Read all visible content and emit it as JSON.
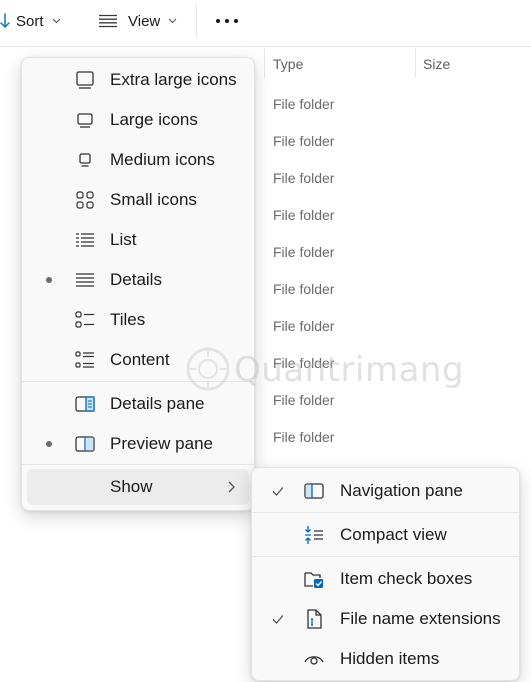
{
  "toolbar": {
    "sort_label": "Sort",
    "view_label": "View",
    "more_icon": "more-icon"
  },
  "columns": [
    {
      "label": "Type"
    },
    {
      "label": "Size"
    }
  ],
  "rows": [
    {
      "type": "File folder"
    },
    {
      "type": "File folder"
    },
    {
      "type": "File folder"
    },
    {
      "type": "File folder"
    },
    {
      "type": "File folder"
    },
    {
      "type": "File folder"
    },
    {
      "type": "File folder"
    },
    {
      "type": "File folder"
    },
    {
      "type": "File folder"
    },
    {
      "type": "File folder"
    }
  ],
  "view_menu": {
    "items": [
      {
        "label": "Extra large icons",
        "icon": "extra-large-icons-icon",
        "selected": false
      },
      {
        "label": "Large icons",
        "icon": "large-icons-icon",
        "selected": false
      },
      {
        "label": "Medium icons",
        "icon": "medium-icons-icon",
        "selected": false
      },
      {
        "label": "Small icons",
        "icon": "small-icons-icon",
        "selected": false
      },
      {
        "label": "List",
        "icon": "list-icon",
        "selected": false
      },
      {
        "label": "Details",
        "icon": "details-icon",
        "selected": true
      },
      {
        "label": "Tiles",
        "icon": "tiles-icon",
        "selected": false
      },
      {
        "label": "Content",
        "icon": "content-icon",
        "selected": false
      },
      {
        "label": "Details pane",
        "icon": "details-pane-icon",
        "selected": false
      },
      {
        "label": "Preview pane",
        "icon": "preview-pane-icon",
        "selected": true
      }
    ],
    "show_label": "Show"
  },
  "show_menu": {
    "items": [
      {
        "label": "Navigation pane",
        "icon": "navigation-pane-icon",
        "checked": true
      },
      {
        "label": "Compact view",
        "icon": "compact-view-icon",
        "checked": false
      },
      {
        "label": "Item check boxes",
        "icon": "item-check-boxes-icon",
        "checked": false
      },
      {
        "label": "File name extensions",
        "icon": "file-name-extensions-icon",
        "checked": true
      },
      {
        "label": "Hidden items",
        "icon": "hidden-items-icon",
        "checked": false
      }
    ]
  },
  "colors": {
    "accent": "#0067c0",
    "menu_bg": "#f9f9f9",
    "hover_bg": "#ececec"
  },
  "watermark": {
    "text": "Quantrimang"
  }
}
